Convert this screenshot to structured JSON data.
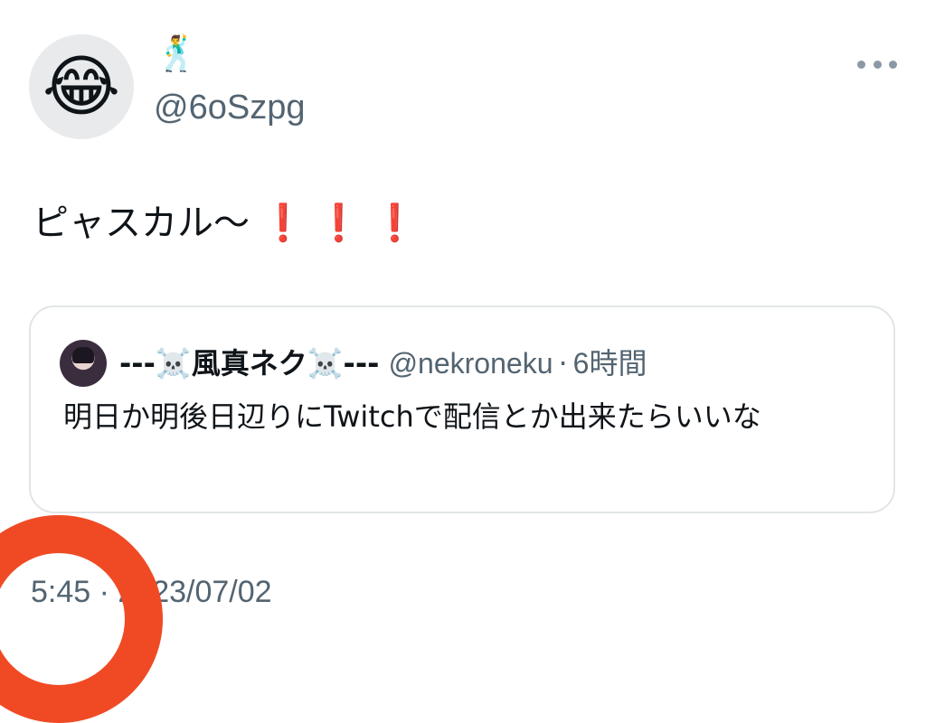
{
  "tweet": {
    "avatar_emoji": "😂",
    "display_name": "🕺",
    "handle": "@6oSzpg",
    "text": "ピャスカル〜",
    "exclamations": [
      "❗",
      "❗",
      "❗"
    ],
    "timestamp": "5:45 · 2023/07/02"
  },
  "quote": {
    "name": "---☠️風真ネク☠️---",
    "handle": "@nekroneku",
    "separator": "·",
    "time": "6時間",
    "text": "明日か明後日辺りにTwitchで配信とか出来たらいいな"
  },
  "colors": {
    "text": "#0f1419",
    "muted": "#536471",
    "border": "#e1e5e8",
    "annotation": "#f04a24",
    "exclamation": "#e0161d"
  },
  "icons": {
    "more": "more-horizontal-icon"
  }
}
